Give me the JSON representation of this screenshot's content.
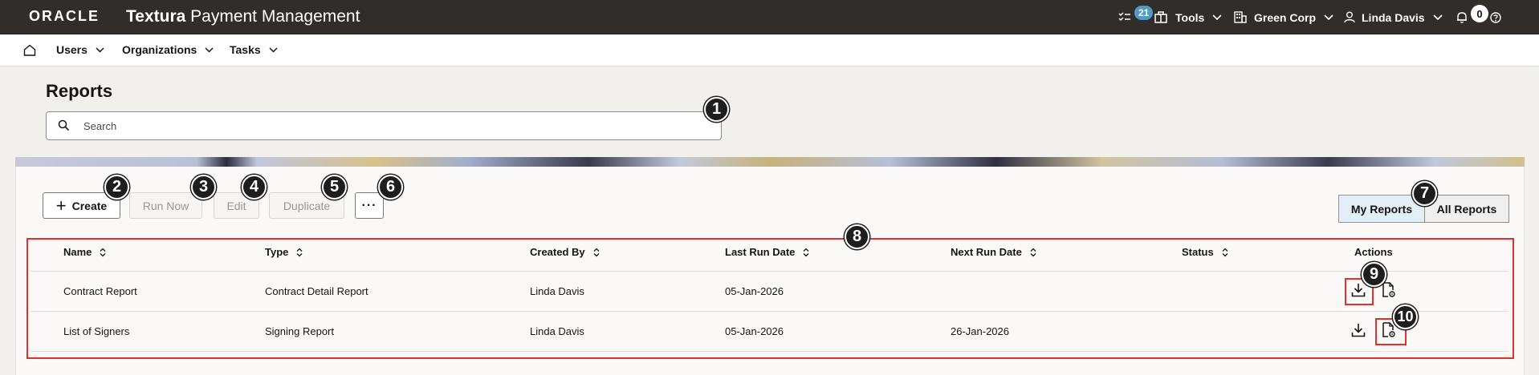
{
  "header": {
    "brand": "ORACLE",
    "app_title_bold": "Textura",
    "app_title_rest": " Payment Management",
    "tasks_badge": "21",
    "tools_label": "Tools",
    "org_label": "Green Corp",
    "user_label": "Linda Davis",
    "notifications_count": "0",
    "icons": [
      "task-list-icon",
      "toolbox-icon",
      "building-icon",
      "user-icon",
      "bell-icon",
      "help-icon"
    ]
  },
  "nav": {
    "items": [
      {
        "label": "Users"
      },
      {
        "label": "Organizations"
      },
      {
        "label": "Tasks"
      }
    ]
  },
  "page": {
    "title": "Reports",
    "search_placeholder": "Search"
  },
  "toolbar": {
    "create_label": "Create",
    "run_now_label": "Run Now",
    "edit_label": "Edit",
    "duplicate_label": "Duplicate",
    "more_label": "···",
    "my_reports_label": "My Reports",
    "all_reports_label": "All Reports"
  },
  "table": {
    "columns": [
      "Name",
      "Type",
      "Created By",
      "Last Run Date",
      "Next Run Date",
      "Status",
      "Actions"
    ],
    "rows": [
      {
        "name": "Contract Report",
        "type": "Contract Detail Report",
        "created_by": "Linda Davis",
        "last_run": "05-Jan-2026",
        "next_run": "",
        "status": ""
      },
      {
        "name": "List of Signers",
        "type": "Signing Report",
        "created_by": "Linda Davis",
        "last_run": "05-Jan-2026",
        "next_run": "26-Jan-2026",
        "status": ""
      }
    ]
  },
  "callouts": [
    "1",
    "2",
    "3",
    "4",
    "5",
    "6",
    "7",
    "8",
    "9",
    "10"
  ],
  "colors": {
    "header_bg": "#312d2a",
    "highlight": "#e0312c",
    "active_segment": "#e3eff7"
  }
}
